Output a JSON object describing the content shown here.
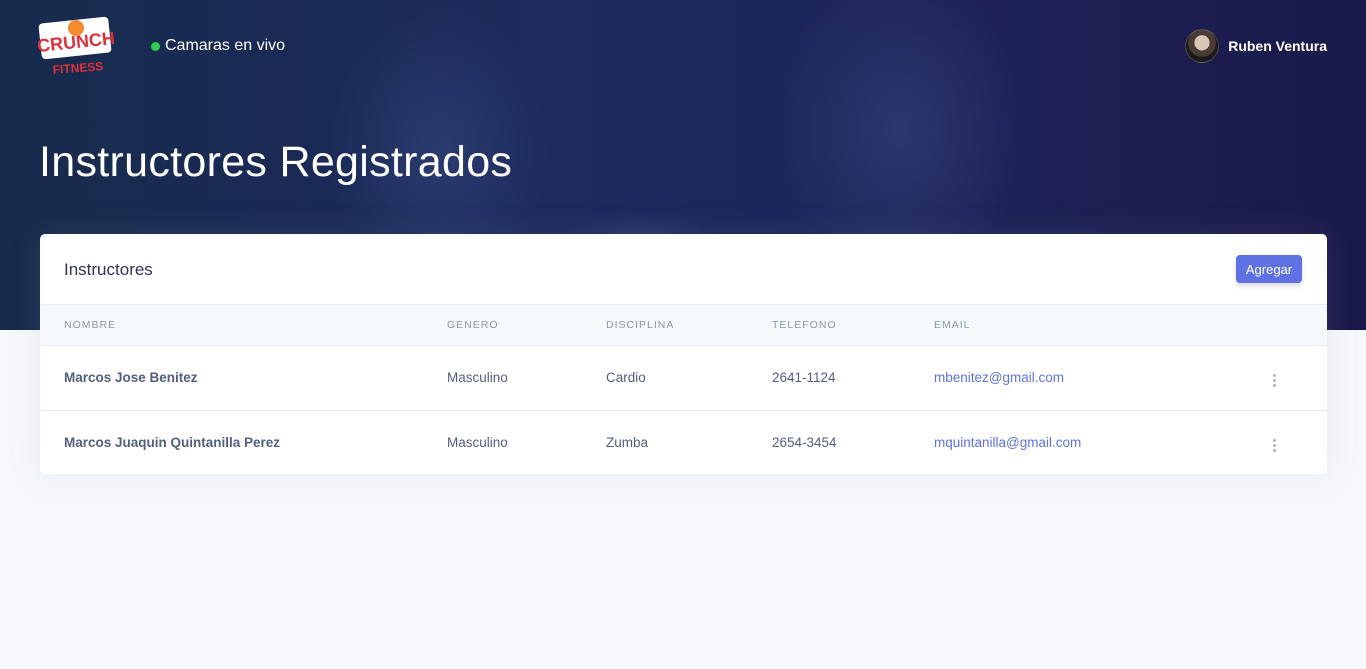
{
  "brand": {
    "logo_line1": "CRUNCH",
    "logo_line2": "FITNESS",
    "logo_color": "#e0303a"
  },
  "nav": {
    "live_cameras_label": "Camaras en vivo",
    "status_color": "#2dce4f"
  },
  "user": {
    "name": "Ruben Ventura"
  },
  "page": {
    "title": "Instructores Registrados"
  },
  "card": {
    "title": "Instructores",
    "add_button_label": "Agregar",
    "accent_color": "#5e72e4"
  },
  "table": {
    "columns": [
      "NOMBRE",
      "GENERO",
      "DISCIPLINA",
      "TELEFONO",
      "EMAIL"
    ],
    "rows": [
      {
        "nombre": "Marcos Jose Benitez",
        "genero": "Masculino",
        "disciplina": "Cardio",
        "telefono": "2641-1124",
        "email": "mbenitez@gmail.com"
      },
      {
        "nombre": "Marcos Juaquin Quintanilla Perez",
        "genero": "Masculino",
        "disciplina": "Zumba",
        "telefono": "2654-3454",
        "email": "mquintanilla@gmail.com"
      }
    ]
  }
}
